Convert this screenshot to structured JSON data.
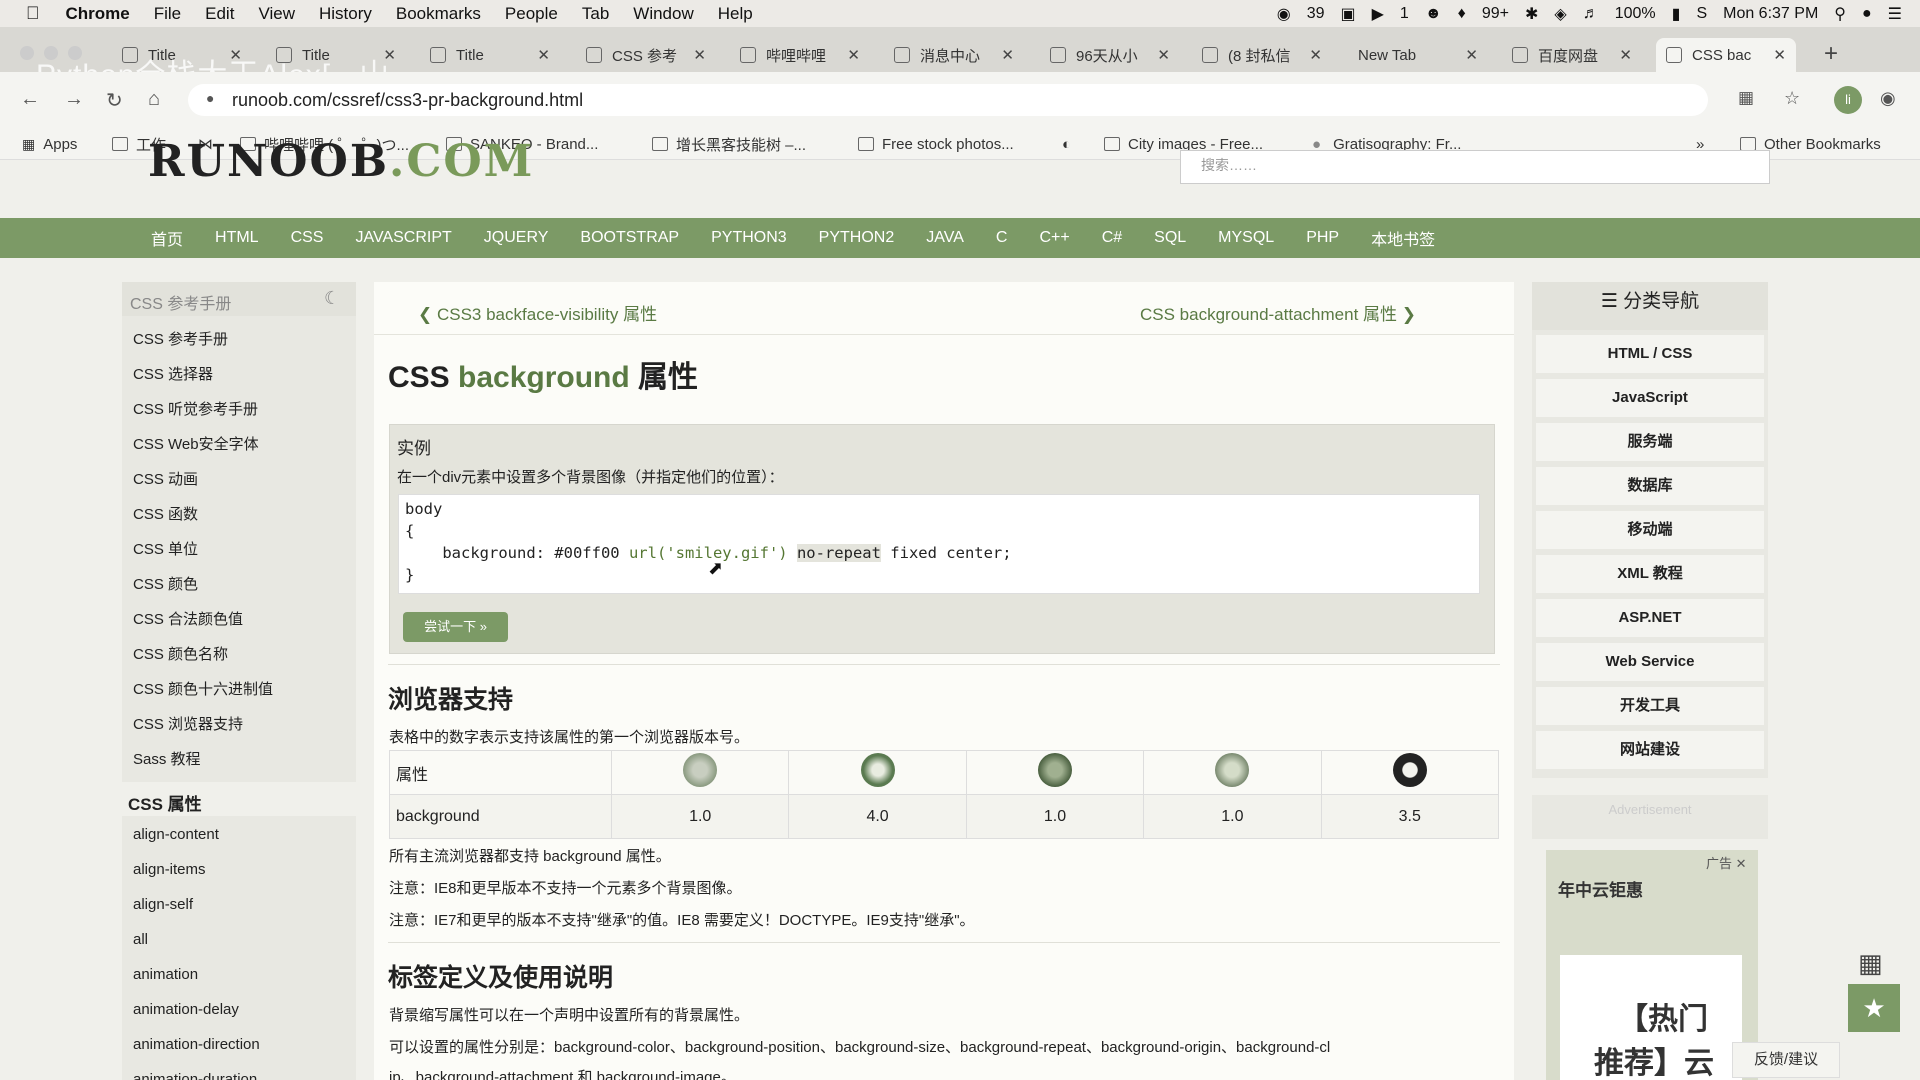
{
  "menubar": {
    "app": "Chrome",
    "items": [
      "File",
      "Edit",
      "View",
      "History",
      "Bookmarks",
      "People",
      "Tab",
      "Window",
      "Help"
    ],
    "status": {
      "wechat": "39",
      "play": "1",
      "qq": "99+",
      "battery": "100%",
      "clock": "Mon 6:37 PM"
    }
  },
  "overlay_title": "Python全栈大王Alex[...山...",
  "tabs": [
    {
      "label": "Title"
    },
    {
      "label": "Title"
    },
    {
      "label": "Title"
    },
    {
      "label": "CSS 参考"
    },
    {
      "label": "哔哩哔哩"
    },
    {
      "label": "消息中心"
    },
    {
      "label": "96天从小"
    },
    {
      "label": "(8 封私信"
    },
    {
      "label": "New Tab"
    },
    {
      "label": "百度网盘"
    },
    {
      "label": "CSS bac"
    }
  ],
  "url": "runoob.com/cssref/css3-pr-background.html",
  "bookmarks": [
    {
      "label": "Apps"
    },
    {
      "label": "工作"
    },
    {
      "label": "哔哩哔哩 ( ゜- ゜)つ..."
    },
    {
      "label": "SANKEO - Brand..."
    },
    {
      "label": "增长黑客技能树 –..."
    },
    {
      "label": "Free stock photos..."
    },
    {
      "label": "City images - Free..."
    },
    {
      "label": "Gratisography: Fr..."
    },
    {
      "label": "Other Bookmarks"
    }
  ],
  "logo": {
    "main": "RUNOOB",
    "suffix": ".COM"
  },
  "search_placeholder": "搜索……",
  "nav": [
    "首页",
    "HTML",
    "CSS",
    "JAVASCRIPT",
    "JQUERY",
    "BOOTSTRAP",
    "PYTHON3",
    "PYTHON2",
    "JAVA",
    "C",
    "C++",
    "C#",
    "SQL",
    "MYSQL",
    "PHP",
    "本地书签"
  ],
  "left_sidebar": {
    "title": "CSS 参考手册",
    "items": [
      "CSS 参考手册",
      "CSS 选择器",
      "CSS 听觉参考手册",
      "CSS Web安全字体",
      "CSS 动画",
      "CSS 函数",
      "CSS 单位",
      "CSS 颜色",
      "CSS 合法颜色值",
      "CSS 颜色名称",
      "CSS 颜色十六进制值",
      "CSS 浏览器支持",
      "Sass 教程"
    ],
    "section2_title": "CSS 属性",
    "section2_items": [
      "align-content",
      "align-items",
      "align-self",
      "all",
      "animation",
      "animation-delay",
      "animation-direction",
      "animation-duration"
    ]
  },
  "main": {
    "prev": "CSS3 backface-visibility 属性",
    "next": "CSS background-attachment 属性",
    "title_prefix": "CSS ",
    "title_green": "background",
    "title_suffix": " 属性",
    "example_label": "实例",
    "example_desc": "在一个div元素中设置多个背景图像（并指定他们的位置）：",
    "code": {
      "l1": "body",
      "l2": "{",
      "l3a": "    background: #00ff00 ",
      "l3b": "url('smiley.gif')",
      "l3c": " ",
      "l3d": "no-repeat",
      "l3e": " fixed center;",
      "l4": "}"
    },
    "try_btn": "尝试一下 »",
    "support_title": "浏览器支持",
    "support_desc": "表格中的数字表示支持该属性的第一个浏览器版本号。",
    "table": {
      "header_label": "属性",
      "row_label": "background",
      "values": [
        "1.0",
        "4.0",
        "1.0",
        "1.0",
        "3.5"
      ]
    },
    "notes": [
      "所有主流浏览器都支持 background 属性。",
      "注意：IE8和更早版本不支持一个元素多个背景图像。",
      "注意：IE7和更早的版本不支持\"继承\"的值。IE8 需要定义！DOCTYPE。IE9支持\"继承\"。"
    ],
    "def_title": "标签定义及使用说明",
    "def_p1": "背景缩写属性可以在一个声明中设置所有的背景属性。",
    "def_p2": "可以设置的属性分别是：background-color、background-position、background-size、background-repeat、background-origin、background-cl",
    "def_p3": "ip、background-attachment 和 background-image。"
  },
  "right_sidebar": {
    "title": "分类导航",
    "items": [
      "HTML / CSS",
      "JavaScript",
      "服务端",
      "数据库",
      "移动端",
      "XML 教程",
      "ASP.NET",
      "Web Service",
      "开发工具",
      "网站建设"
    ],
    "advertisement": "Advertisement"
  },
  "ad": {
    "tag": "广告",
    "title": "年中云钜惠",
    "big1": "【热门",
    "big2": "推荐】云"
  },
  "feedback": "反馈/建议",
  "colors": {
    "nav_green": "#7c9a66",
    "link_green": "#5a7a44"
  }
}
